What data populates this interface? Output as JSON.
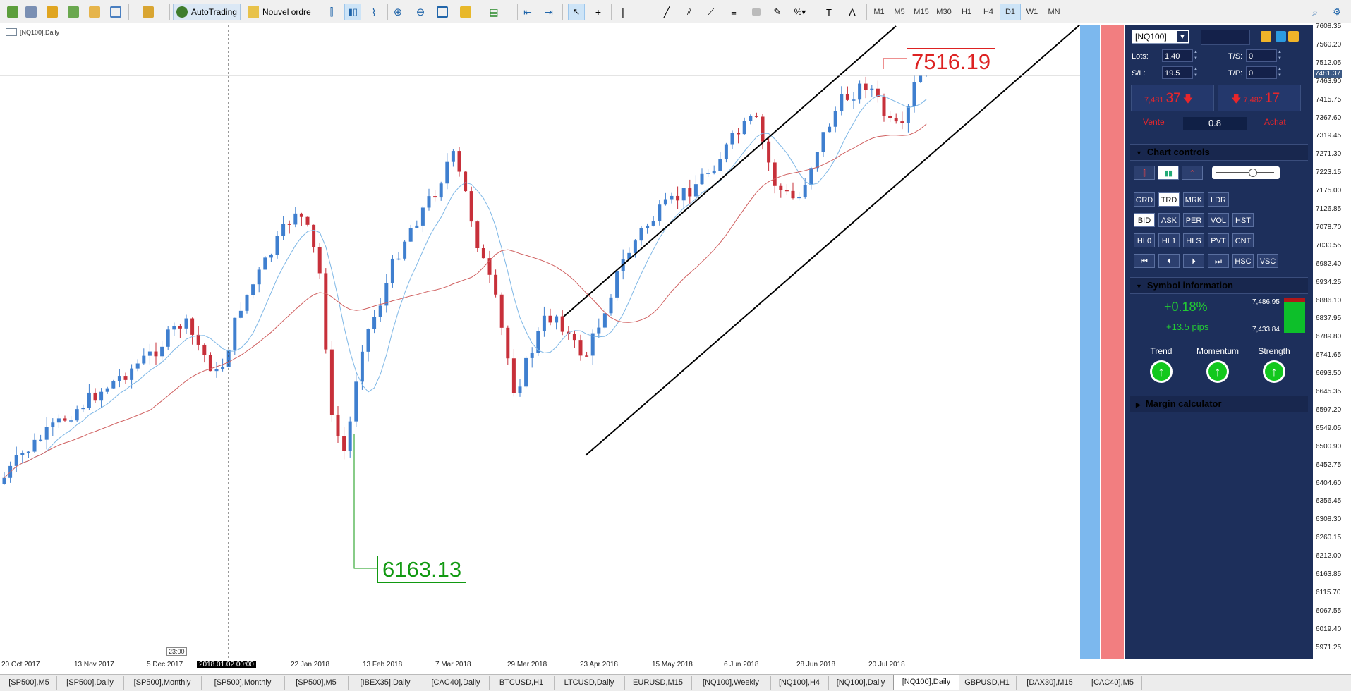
{
  "toolbar": {
    "autotrading_label": "AutoTrading",
    "new_order_label": "Nouvel ordre",
    "timeframes": [
      "M1",
      "M5",
      "M15",
      "M30",
      "H1",
      "H4",
      "D1",
      "W1",
      "MN"
    ],
    "active_timeframe": "D1"
  },
  "chart": {
    "symbol_label": "[NQ100],Daily",
    "high_label": "7516.19",
    "low_label": "6163.13",
    "current_price_tag": "7481.37",
    "time_marker": "23:00",
    "x_labels": [
      "20 Oct 2017",
      "13 Nov 2017",
      "5 Dec 2017",
      "2018.01.02 00:00",
      "22 Jan 2018",
      "13 Feb 2018",
      "7 Mar 2018",
      "29 Mar 2018",
      "23 Apr 2018",
      "15 May 2018",
      "6 Jun 2018",
      "28 Jun 2018",
      "20 Jul 2018"
    ],
    "y_labels": [
      "7608.35",
      "7560.20",
      "7512.05",
      "7463.90",
      "7415.75",
      "7367.60",
      "7319.45",
      "7271.30",
      "7223.15",
      "7175.00",
      "7126.85",
      "7078.70",
      "7030.55",
      "6982.40",
      "6934.25",
      "6886.10",
      "6837.95",
      "6789.80",
      "6741.65",
      "6693.50",
      "6645.35",
      "6597.20",
      "6549.05",
      "6500.90",
      "6452.75",
      "6404.60",
      "6356.45",
      "6308.30",
      "6260.15",
      "6212.00",
      "6163.85",
      "6115.70",
      "6067.55",
      "6019.40",
      "5971.25"
    ],
    "colors": {
      "bull": "#3f7fcf",
      "bear": "#c7303a",
      "ma_fast": "#7eb7e6",
      "ma_slow": "#d06060"
    }
  },
  "panel": {
    "symbol": "[NQ100]",
    "lots_label": "Lots:",
    "lots_value": "1.40",
    "sl_label": "S/L:",
    "sl_value": "19.5",
    "ts_label": "T/S:",
    "ts_value": "0",
    "tp_label": "T/P:",
    "tp_value": "0",
    "sell_price_small": "7,481.",
    "sell_price_big": "37",
    "buy_price_small": "7,482.",
    "buy_price_big": "17",
    "sell_label": "Vente",
    "buy_label": "Achat",
    "spread": "0.8",
    "chart_controls_title": "Chart controls",
    "controls_row1": [
      "GRD",
      "TRD",
      "MRK",
      "LDR"
    ],
    "controls_row2": [
      "BID",
      "ASK",
      "PER",
      "VOL",
      "HST"
    ],
    "controls_row3": [
      "HL0",
      "HL1",
      "HLS",
      "PVT",
      "CNT"
    ],
    "controls_row4": [
      "⏮",
      "⏴",
      "⏵",
      "⏭",
      "HSC",
      "VSC"
    ],
    "symbol_info_title": "Symbol information",
    "change_pct": "+0.18%",
    "change_pips": "+13.5 pips",
    "range_high": "7,486.95",
    "range_low": "7,433.84",
    "trend_label": "Trend",
    "momentum_label": "Momentum",
    "strength_label": "Strength",
    "margin_title": "Margin calculator"
  },
  "tabs": [
    "[SP500],M5",
    "[SP500],Daily",
    "[SP500],Monthly",
    "[SP500],Monthly",
    "[SP500],M5",
    "[IBEX35],Daily",
    "[CAC40],Daily",
    "BTCUSD,H1",
    "LTCUSD,Daily",
    "EURUSD,M15",
    "[NQ100],Weekly",
    "[NQ100],H4",
    "[NQ100],Daily",
    "[NQ100],Daily",
    "GBPUSD,H1",
    "[DAX30],M15",
    "[CAC40],M5"
  ],
  "active_tab_index": 13
}
